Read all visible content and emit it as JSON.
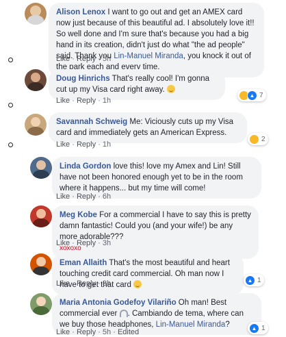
{
  "comments": [
    {
      "author": "Alison Lenox",
      "text_before": " I want to go out and get an AMEX card now just because of this beautiful ad. I absolutely love it!! So well done and I'm sure that's because you had a big hand in its creation, didn't just do what \"the ad people\" said. Thank you ",
      "mention": "Lin-Manuel Miranda",
      "text_after": ", you knock it out of the park each and every time.",
      "like": "Like",
      "reply": "Reply",
      "time": "5h",
      "avatar_color": "#b98b5a"
    },
    {
      "author": "Doug Hinrichs",
      "text_before": " That's really cool! I'm gonna cut up my Visa card right away. ",
      "like": "Like",
      "reply": "Reply",
      "time": "1h",
      "reaction_count": "7",
      "avatar_color": "#6d4b3b"
    },
    {
      "author": "Savannah Schweig",
      "text_before": " Me: Viciously cuts up my Visa card and immediately gets an American Express.",
      "like": "Like",
      "reply": "Reply",
      "time": "1h",
      "reaction_count": "2",
      "avatar_color": "#c9a77c"
    },
    {
      "author": "Linda Gordon",
      "text_before": " love this! love my Amex and Lin! Still have not been honored enough yet to be in the room where it happens... but my time will come!",
      "like": "Like",
      "reply": "Reply",
      "time": "6h",
      "avatar_color": "#4f6a8a"
    },
    {
      "author": "Meg Kobe",
      "text_before": " For a commercial I have to say this is pretty damn fantastic! Could you (and your wife!) be any more adorable???",
      "extra": "xoxoxo",
      "like": "Like",
      "reply": "Reply",
      "time": "3h",
      "avatar_color": "#c0392b"
    },
    {
      "author": "Eman Allaith",
      "text_before": " That's the most beautiful and heart touching credit card commercial. Oh man now I have to get that card ",
      "like": "Like",
      "reply": "Reply",
      "time": "3h",
      "reaction_count": "1",
      "avatar_color": "#d35400"
    },
    {
      "author": "Maria Antonia Godefoy Vilariño",
      "text_before": " Oh man! Best commercial ever ",
      "text_middle": ". Cambiando de tema, where can we buy those headphones, ",
      "mention": "Lin-Manuel Miranda",
      "text_after": "?",
      "like": "Like",
      "reply": "Reply",
      "time": "5h",
      "edited": "Edited",
      "reaction_count": "1",
      "avatar_color": "#7f9c6a"
    }
  ],
  "separator": "·",
  "colors": {
    "author": "#385898",
    "bubble": "#f2f3f5",
    "meta": "#606770"
  }
}
